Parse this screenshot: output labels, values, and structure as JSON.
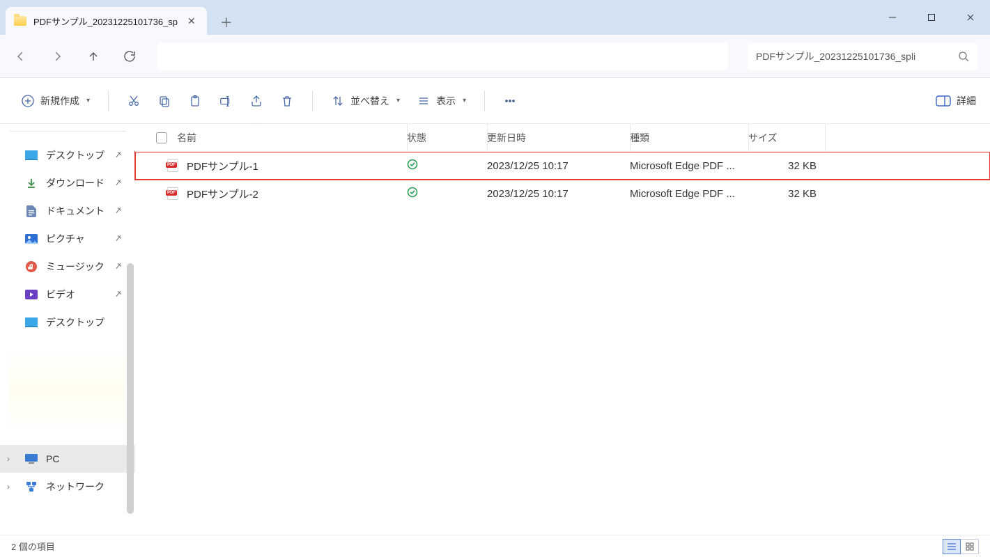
{
  "tab": {
    "title": "PDFサンプル_20231225101736_sp"
  },
  "search": {
    "text": "PDFサンプル_20231225101736_spli"
  },
  "toolbar": {
    "new": "新規作成",
    "sort": "並べ替え",
    "view": "表示",
    "details": "詳細"
  },
  "sidebar": {
    "desktop": "デスクトップ",
    "downloads": "ダウンロード",
    "documents": "ドキュメント",
    "pictures": "ピクチャ",
    "music": "ミュージック",
    "videos": "ビデオ",
    "desktop2": "デスクトップ",
    "pc": "PC",
    "network": "ネットワーク"
  },
  "columns": {
    "name": "名前",
    "status": "状態",
    "modified": "更新日時",
    "type": "種類",
    "size": "サイズ"
  },
  "files": [
    {
      "name": "PDFサンプル-1",
      "modified": "2023/12/25 10:17",
      "type": "Microsoft Edge PDF ...",
      "size": "32 KB"
    },
    {
      "name": "PDFサンプル-2",
      "modified": "2023/12/25 10:17",
      "type": "Microsoft Edge PDF ...",
      "size": "32 KB"
    }
  ],
  "status": {
    "count_label": "2 個の項目"
  }
}
